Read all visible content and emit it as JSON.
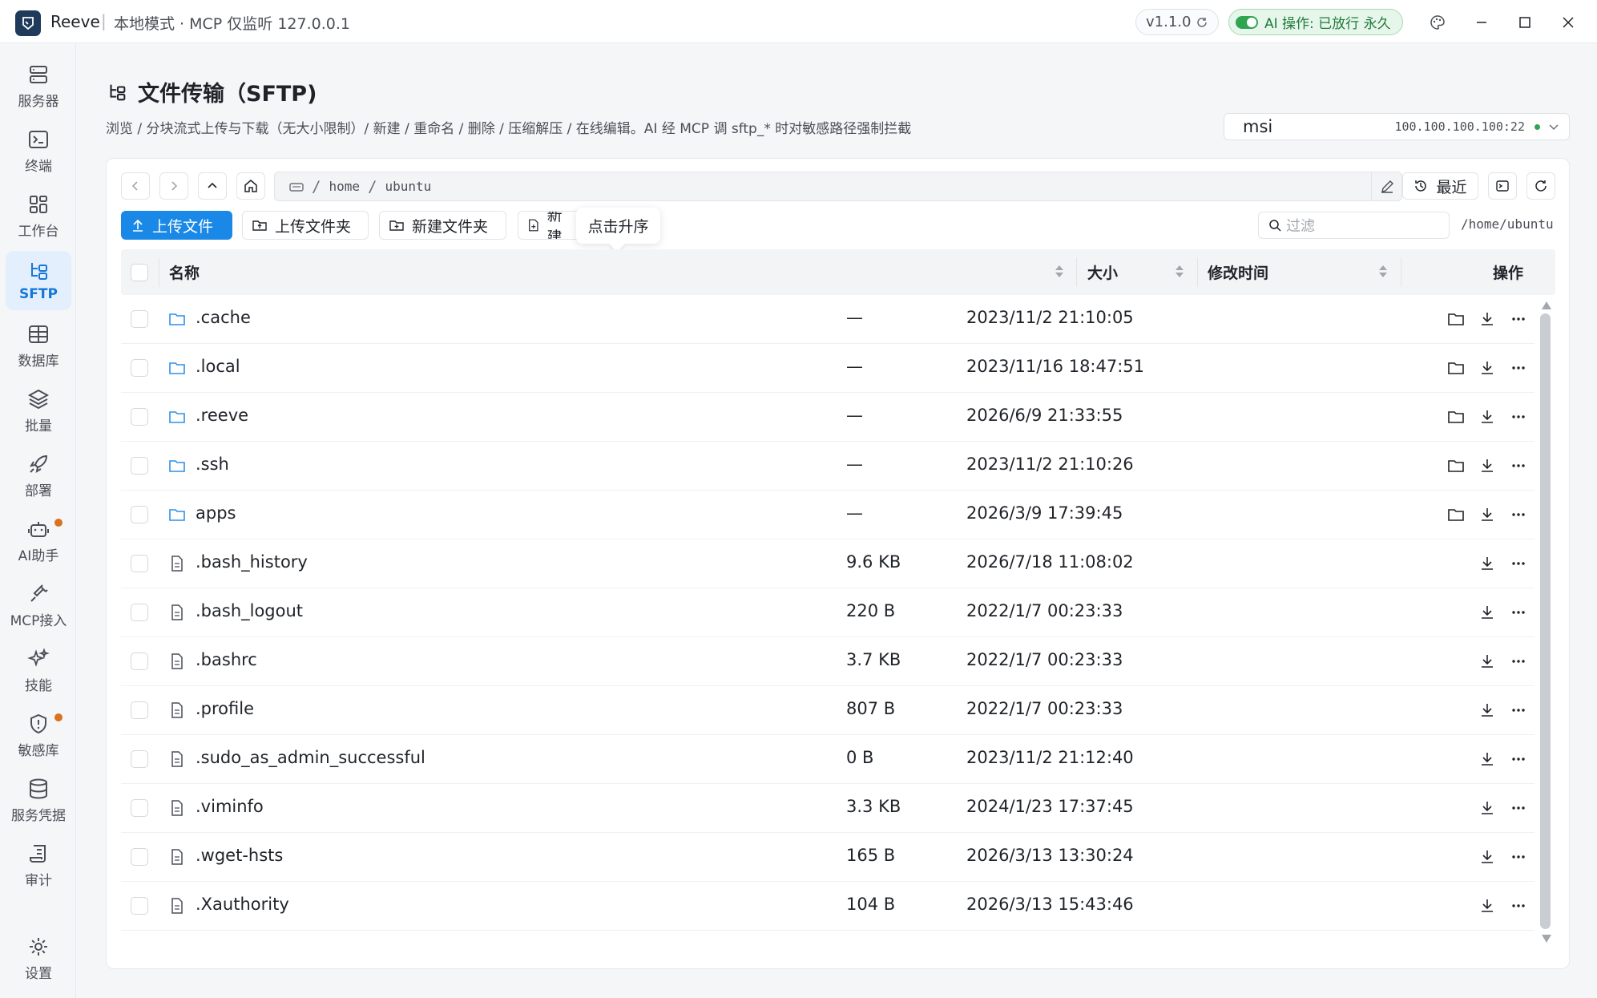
{
  "window": {
    "app_name": "Reeve",
    "separator": "|",
    "mode": "本地模式 · MCP 仅监听 127.0.0.1",
    "version": "v1.1.0",
    "ai_status": "AI 操作: 已放行 永久"
  },
  "sidebar": {
    "items": [
      {
        "label": "服务器",
        "icon": "server-icon"
      },
      {
        "label": "终端",
        "icon": "terminal-icon"
      },
      {
        "label": "工作台",
        "icon": "dashboard-icon"
      },
      {
        "label": "SFTP",
        "icon": "sftp-icon",
        "active": true
      },
      {
        "label": "数据库",
        "icon": "database-table-icon"
      },
      {
        "label": "批量",
        "icon": "layers-icon"
      },
      {
        "label": "部署",
        "icon": "rocket-icon"
      },
      {
        "label": "AI助手",
        "icon": "robot-icon",
        "badge": true
      },
      {
        "label": "MCP接入",
        "icon": "plug-icon"
      },
      {
        "label": "技能",
        "icon": "sparkles-icon"
      },
      {
        "label": "敏感库",
        "icon": "shield-alert-icon",
        "badge": true
      },
      {
        "label": "服务凭据",
        "icon": "cylinder-icon"
      },
      {
        "label": "审计",
        "icon": "scroll-icon"
      },
      {
        "label": "设置",
        "icon": "gear-icon"
      }
    ],
    "badge_color": "#d9731f",
    "active_color": "#1677d9"
  },
  "header": {
    "title": "文件传输（SFTP)",
    "description": "浏览 / 分块流式上传与下载（无大小限制）/ 新建 / 重命名 / 删除 / 压缩解压 / 在线编辑。AI 经 MCP 调 sftp_* 时对敏感路径强制拦截"
  },
  "server": {
    "name": "msi",
    "address": "100.100.100.100:22",
    "status_color": "#2fa552"
  },
  "path": {
    "segments": [
      "home",
      "ubuntu"
    ],
    "separator": "/",
    "recent_label": "最近",
    "current": "/home/ubuntu"
  },
  "actions": {
    "upload_file": "上传文件",
    "upload_folder": "上传文件夹",
    "new_folder": "新建文件夹",
    "new_file": "新建",
    "tooltip": "点击升序",
    "filter_placeholder": "过滤"
  },
  "table": {
    "columns": {
      "name": "名称",
      "size": "大小",
      "mtime": "修改时间",
      "ops": "操作"
    },
    "rows": [
      {
        "name": ".cache",
        "type": "folder",
        "size": "—",
        "mtime": "2023/11/2 21:10:05"
      },
      {
        "name": ".local",
        "type": "folder",
        "size": "—",
        "mtime": "2023/11/16 18:47:51"
      },
      {
        "name": ".reeve",
        "type": "folder",
        "size": "—",
        "mtime": "2026/6/9 21:33:55"
      },
      {
        "name": ".ssh",
        "type": "folder",
        "size": "—",
        "mtime": "2023/11/2 21:10:26"
      },
      {
        "name": "apps",
        "type": "folder",
        "size": "—",
        "mtime": "2026/3/9 17:39:45"
      },
      {
        "name": ".bash_history",
        "type": "file",
        "size": "9.6 KB",
        "mtime": "2026/7/18 11:08:02"
      },
      {
        "name": ".bash_logout",
        "type": "file",
        "size": "220 B",
        "mtime": "2022/1/7 00:23:33"
      },
      {
        "name": ".bashrc",
        "type": "file",
        "size": "3.7 KB",
        "mtime": "2022/1/7 00:23:33"
      },
      {
        "name": ".profile",
        "type": "file",
        "size": "807 B",
        "mtime": "2022/1/7 00:23:33"
      },
      {
        "name": ".sudo_as_admin_successful",
        "type": "file",
        "size": "0 B",
        "mtime": "2023/11/2 21:12:40"
      },
      {
        "name": ".viminfo",
        "type": "file",
        "size": "3.3 KB",
        "mtime": "2024/1/23 17:37:45"
      },
      {
        "name": ".wget-hsts",
        "type": "file",
        "size": "165 B",
        "mtime": "2026/3/13 13:30:24"
      },
      {
        "name": ".Xauthority",
        "type": "file",
        "size": "104 B",
        "mtime": "2026/3/13 15:43:46"
      }
    ]
  },
  "colors": {
    "primary": "#1a88e6",
    "folder_icon": "#2f8fe8",
    "ai_green": "#1f7a3a"
  }
}
